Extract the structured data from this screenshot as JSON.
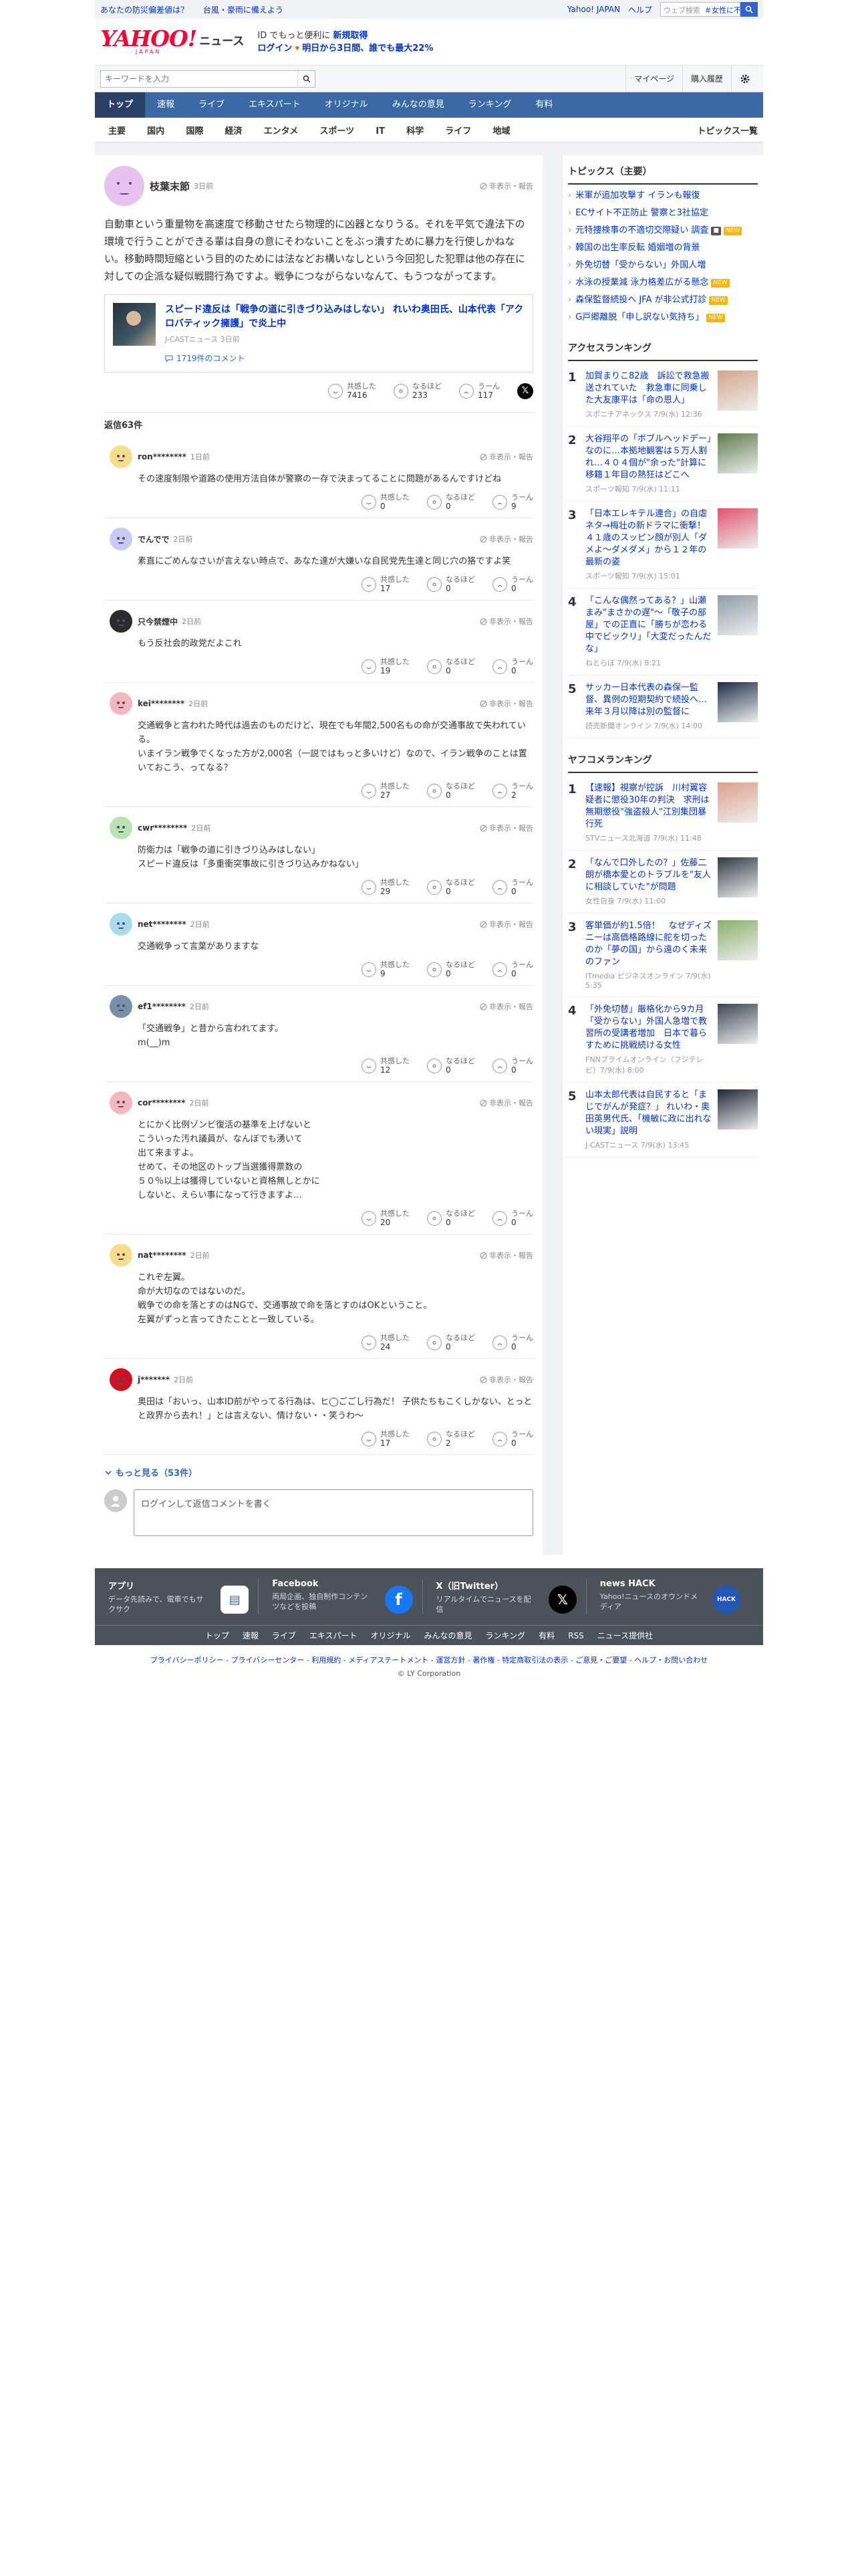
{
  "colors": {
    "brand": "#ff0033",
    "nav": "#3a69a3",
    "navActive": "#293f66",
    "link": "#0033cc",
    "accent": "#2e6ac6",
    "badge": "#ffb400",
    "footer": "#4c5259"
  },
  "util": {
    "promos": [
      "あなたの防災偏差値は？",
      "台風・豪雨に備えよう"
    ],
    "links": [
      "Yahoo! JAPAN",
      "ヘルプ"
    ],
    "search_placeholder": "ウェブ検索",
    "trend": "＃女性に不適切..."
  },
  "masthead": {
    "logo_main": "YAHOO!",
    "logo_sub": "JAPAN",
    "service": "ニュース",
    "promo_line1_prefix": "ID でもっと便利に",
    "promo_line1_link": "新規取得",
    "promo_line2_link": "ログイン",
    "promo_line2_text": "明日から3日間、誰でも最大22%"
  },
  "searchbar": {
    "placeholder": "キーワードを入力",
    "mypage": "マイページ",
    "history": "購入履歴"
  },
  "tabs": [
    "トップ",
    "速報",
    "ライブ",
    "エキスパート",
    "オリジナル",
    "みんなの意見",
    "ランキング",
    "有料"
  ],
  "categories": [
    "主要",
    "国内",
    "国際",
    "経済",
    "エンタメ",
    "スポーツ",
    "IT",
    "科学",
    "ライフ",
    "地域"
  ],
  "topics_link": "トピックス一覧",
  "parent": {
    "user": "枝葉末節",
    "ago": "3日前",
    "hide": "非表示・報告",
    "text": "自動車という重量物を高速度で移動させたら物理的に凶器となりうる。それを平気で違法下の環境で行うことができる輩は自身の意にそわないことをぶっ潰すために暴力を行使しかねない。移動時間短縮という目的のためには法などお構いなしという今回犯した犯罪は他の存在に対しての企派な疑似戦闘行為ですよ。戦争につながらないなんて、もうつながってます。",
    "article": {
      "title": "スピード違反は「戦争の道に引きづり込みはしない」 れいわ奥田氏、山本代表「アクロバティック擁護」で炎上中",
      "meta": "J-CASTニュース 3日前"
    },
    "comment_count": "1719件のコメント",
    "reactions": [
      {
        "label": "共感した",
        "count": "7416"
      },
      {
        "label": "なるほど",
        "count": "233"
      },
      {
        "label": "うーん",
        "count": "117"
      }
    ]
  },
  "reply_header": {
    "prefix": "返信",
    "count": "63",
    "suffix": "件"
  },
  "replies": [
    {
      "user": "ron********",
      "ago": "1日前",
      "avatar": "#f6dd8c",
      "text": "その速度制限や道路の使用方法自体が警察の一存で決まってることに問題があるんですけどね",
      "reactions": [
        "0",
        "0",
        "9"
      ]
    },
    {
      "user": "でんでで",
      "ago": "2日前",
      "avatar": "#c9c9f6",
      "text": "素直にごめんなさいが言えない時点で、あなた達が大嫌いな自民党先生達と同じ穴の狢ですよ笑",
      "reactions": [
        "17",
        "0",
        "0"
      ]
    },
    {
      "user": "只今禁煙中",
      "ago": "2日前",
      "avatar": "#2c2c2c",
      "text": "もう反社会的政党だよこれ",
      "reactions": [
        "19",
        "0",
        "0"
      ]
    },
    {
      "user": "kei********",
      "ago": "2日前",
      "avatar": "#f5b7bf",
      "text": "交通戦争と言われた時代は過去のものだけど、現在でも年間2,500名もの命が交通事故で失われている。\nいまイラン戦争でくなった方が2,000名（一説ではもっと多いけど）なので、イラン戦争のことは置いておこう、ってなる？",
      "reactions": [
        "27",
        "0",
        "2"
      ]
    },
    {
      "user": "cwr********",
      "ago": "2日前",
      "avatar": "#b9e3b0",
      "text": "防衛力は「戦争の道に引きづり込みはしない」\nスピード違反は「多重衝突事故に引きづり込みかねない」",
      "reactions": [
        "29",
        "0",
        "0"
      ]
    },
    {
      "user": "net********",
      "ago": "2日前",
      "avatar": "#a9dbee",
      "text": "交通戦争って言葉がありますな",
      "reactions": [
        "9",
        "0",
        "0"
      ]
    },
    {
      "user": "ef1********",
      "ago": "2日前",
      "avatar": "#7891a9",
      "text": "「交通戦争」と昔から言われてます。\nm(__)m",
      "reactions": [
        "12",
        "0",
        "0"
      ]
    },
    {
      "user": "cor********",
      "ago": "2日前",
      "avatar": "#f5b7bf",
      "text": "とにかく比例ゾンビ復活の基準を上げないと\nこういった汚れ議員が、なんぼでも湧いて\n出て来ますよ。\nせめて、その地区のトップ当選獲得票数の\n５０％以上は獲得していないと資格無しとかに\nしないと、えらい事になって行きますよ…",
      "reactions": [
        "20",
        "0",
        "0"
      ]
    },
    {
      "user": "nat********",
      "ago": "2日前",
      "avatar": "#f6dd8c",
      "text": "これぞ左翼。\n命が大切なのではないのだ。\n戦争での命を落とすのはNGで、交通事故で命を落とすのはOKということ。\n左翼がずっと言ってきたことと一致している。",
      "reactions": [
        "24",
        "0",
        "0"
      ]
    },
    {
      "user": "j*******",
      "ago": "2日前",
      "avatar": "#cc1122",
      "text": "奥田は「おいっ、山本ID前がやってる行為は、ヒ◯ごごし行為だ！ 子供たちもこくしかない、とっとと政界から去れ！」とは言えない、情けない・・笑うわ〜",
      "reactions": [
        "17",
        "2",
        "0"
      ]
    }
  ],
  "reaction_labels": [
    "共感した",
    "なるほど",
    "うーん"
  ],
  "more_label": "もっと見る（53件）",
  "composer_placeholder": "ログインして返信コメントを書く",
  "sidebar": {
    "topics_title": "トピックス（主要）",
    "topics": [
      {
        "text": "米軍が追加攻撃す イランも報復",
        "badge": ""
      },
      {
        "text": "ECサイト不正防止 警察と3社協定",
        "badge": ""
      },
      {
        "text": "元特捜検事の不適切交際疑い 調査",
        "badge": "NEW",
        "photo": true
      },
      {
        "text": "韓国の出生率反転 婚姻増の背景",
        "badge": ""
      },
      {
        "text": "外免切替「受からない」外国人増",
        "badge": ""
      },
      {
        "text": "水泳の授業減 泳力格差広がる懸念",
        "badge": "NEW"
      },
      {
        "text": "森保監督続投へ JFA が非公式打診",
        "badge": "NEW"
      },
      {
        "text": "G戸郷離脱「申し訳ない気持ち」",
        "badge": "NEW"
      }
    ],
    "access_title": "アクセスランキング",
    "access": [
      {
        "title": "加賀まりこ82歳　訴訟で救急搬送されていた　救急車に同乗した大友康平は「命の恩人」",
        "meta": "スポニチアネックス 7/9(水) 12:36",
        "color": "#d3a58c"
      },
      {
        "title": "大谷翔平の「ボブルヘッドデー」なのに…本拠地観客は５万人割れ…４０４個が\"余った\"計算に 移籍１年目の熱狂はどこへ",
        "meta": "スポーツ報知 7/9(水) 11:11",
        "color": "#5d7b4c"
      },
      {
        "title": "「日本エレキテル連合」の自虐ネタ→梅壮の新ドラマに衝撃！４１歳のスッピン顔が別人「ダメよ〜ダメダメ」から１２年の最新の姿",
        "meta": "スポーツ報知 7/9(水) 15:01",
        "color": "#e0536b"
      },
      {
        "title": "「こんな偶然ってある？」山瀬まみ\"まさかの遅\"～「敬子の部屋」での正直に「勝ちが恋わる中でビックリ」「大変だったんだな」",
        "meta": "ねとらぼ 7/9(水) 8:21",
        "color": "#8f9ca6"
      },
      {
        "title": "サッカー日本代表の森保一監督、異例の短期契約で続投へ…来年３月以降は別の監督に",
        "meta": "読売新聞オンライン 7/9(水) 14:00",
        "color": "#1c2c46"
      }
    ],
    "yafoo_title": "ヤフコメランキング",
    "yafoo": [
      {
        "title": "【速報】視察が控訴　川村翼容疑者に懲役30年の判決　求刑は無期懲役\"強盗殺人\"江別集団暴行死",
        "meta": "STVニュース北海道 7/9(水) 11:48",
        "color": "#dca08c"
      },
      {
        "title": "「なんで口外したの？」佐藤二朗が橋本愛とのトラブルを\"友人に相談していた\"が問題",
        "meta": "女性自身 7/9(水) 11:00",
        "color": "#303a44"
      },
      {
        "title": "客単価が約1.5倍！　なぜディズニーは高価格路線に舵を切ったのか「夢の国」から遠のく未来のファン",
        "meta": "ITmedia ビジネスオンライン 7/9(水) 5:35",
        "color": "#8bb06a"
      },
      {
        "title": "「外免切替」厳格化から9カ月「受からない」外国人急増で教習所の受講者増加　日本で暮らすために挑戦続ける女性",
        "meta": "FNNプライムオンライン（フジテレビ）7/9(水) 8:00",
        "color": "#3c4652"
      },
      {
        "title": "山本太郎代表は自民すると「まじでがんが発症？」 れいわ・奥田英男代氏、「機敏に政に出れない現実」説明",
        "meta": "J-CASTニュース 7/9(水) 13:45",
        "color": "#1f2636"
      }
    ]
  },
  "footer": {
    "apps": [
      {
        "title": "アプリ",
        "desc": "データ先読みで、電車でもサクサク",
        "icon": "#ffffff"
      },
      {
        "title": "Facebook",
        "desc": "両局企画、独自制作コンテンツなどを投稿",
        "icon": "#1877f2"
      },
      {
        "title": "X（旧Twitter）",
        "desc": "リアルタイムでニュースを配信",
        "icon": "#000000"
      },
      {
        "title": "news HACK",
        "desc": "Yahoo!ニュースのオウンドメディア",
        "icon": "#2257b8"
      }
    ],
    "nav": [
      "トップ",
      "速報",
      "ライブ",
      "エキスパート",
      "オリジナル",
      "みんなの意見",
      "ランキング",
      "有料",
      "RSS",
      "ニュース提供社"
    ],
    "legal": "プライバシーポリシー - プライバシーセンター - 利用規約 - メディアステートメント - 運営方針 - 著作権 - 特定商取引法の表示 - ご意見・ご要望 - ヘルプ・お問い合わせ",
    "copyright": "© LY Corporation"
  }
}
